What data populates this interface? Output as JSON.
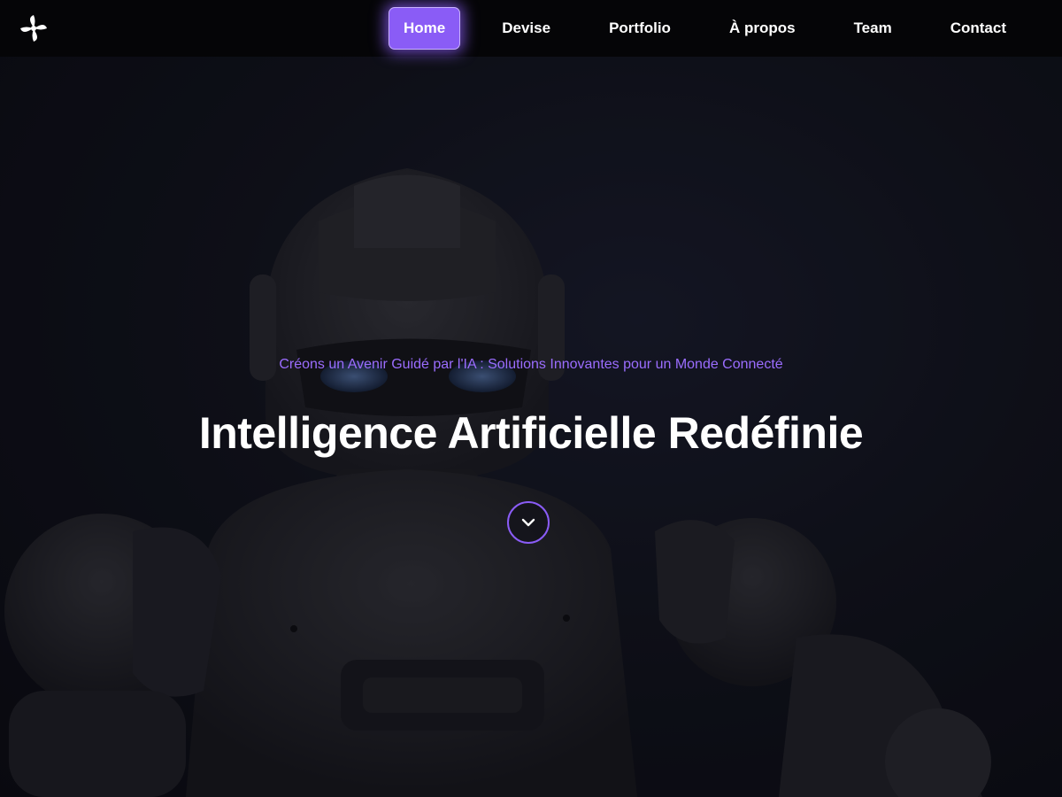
{
  "navbar": {
    "logo_icon": "pinwheel-logo-icon",
    "items": [
      {
        "label": "Home",
        "active": true
      },
      {
        "label": "Devise",
        "active": false
      },
      {
        "label": "Portfolio",
        "active": false
      },
      {
        "label": "À propos",
        "active": false
      },
      {
        "label": "Team",
        "active": false
      },
      {
        "label": "Contact",
        "active": false
      }
    ]
  },
  "hero": {
    "tagline": "Créons un Avenir Guidé par l'IA : Solutions Innovantes pour un Monde Connecté",
    "headline": "Intelligence Artificielle Redéfinie",
    "scroll_icon": "chevron-down-icon",
    "background_image": "robot-photo"
  },
  "colors": {
    "accent": "#8a5cf6",
    "tagline": "#9b6dff",
    "navbar_bg": "#050507",
    "text": "#ffffff"
  }
}
